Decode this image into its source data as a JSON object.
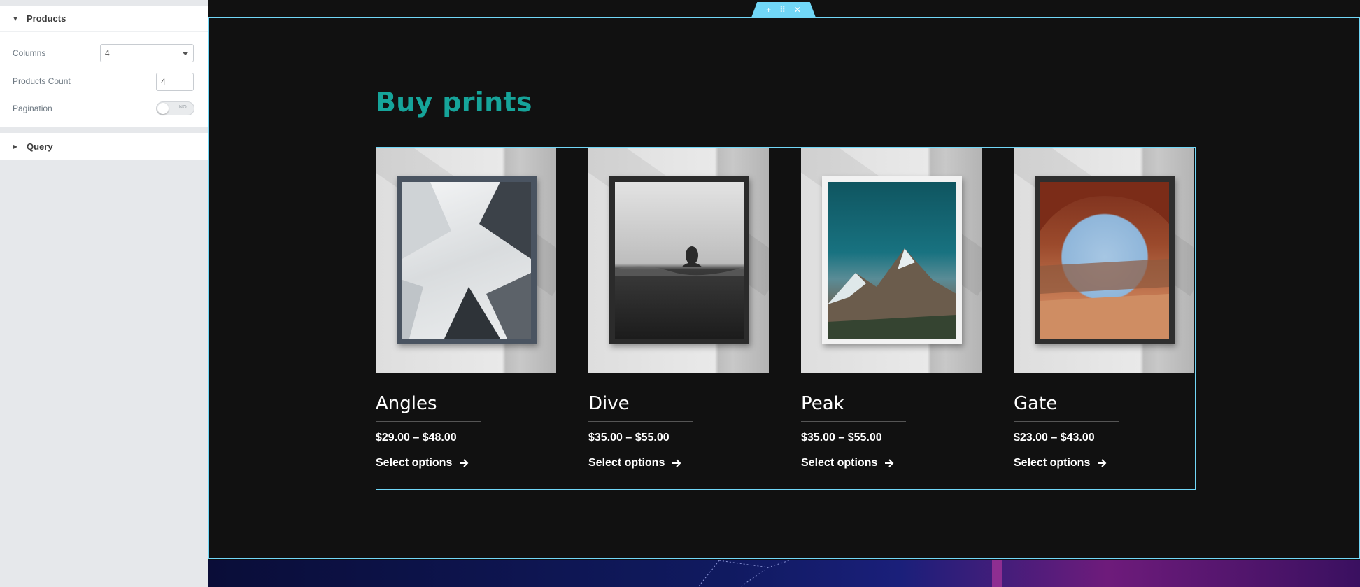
{
  "panel": {
    "products_section": {
      "title": "Products"
    },
    "fields": {
      "columns_label": "Columns",
      "columns_value": "4",
      "products_count_label": "Products Count",
      "products_count_value": "4",
      "pagination_label": "Pagination",
      "pagination_state": "NO"
    },
    "query_section": {
      "title": "Query"
    }
  },
  "canvas": {
    "heading": "Buy prints",
    "heading_color": "#16a49a",
    "selection_color": "#71d7f7",
    "products": [
      {
        "name": "Angles",
        "price": "$29.00 – $48.00",
        "action": "Select options"
      },
      {
        "name": "Dive",
        "price": "$35.00 – $55.00",
        "action": "Select options"
      },
      {
        "name": "Peak",
        "price": "$35.00 – $55.00",
        "action": "Select options"
      },
      {
        "name": "Gate",
        "price": "$23.00 – $43.00",
        "action": "Select options"
      }
    ]
  }
}
